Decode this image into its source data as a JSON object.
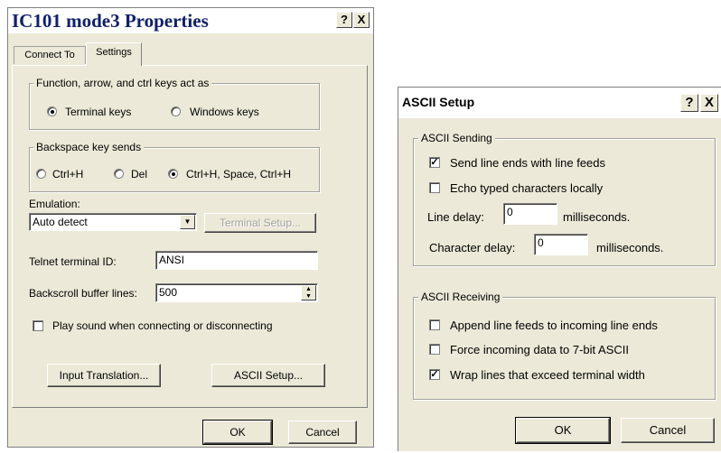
{
  "properties": {
    "title": "IC101 mode3 Properties",
    "help_glyph": "?",
    "close_glyph": "X",
    "tabs": [
      {
        "label": "Connect To",
        "active": false
      },
      {
        "label": "Settings",
        "active": true
      }
    ],
    "function_keys_group": {
      "legend": "Function, arrow, and ctrl keys act as",
      "options": [
        {
          "label": "Terminal keys",
          "selected": true
        },
        {
          "label": "Windows keys",
          "selected": false
        }
      ]
    },
    "backspace_group": {
      "legend": "Backspace key sends",
      "options": [
        {
          "label": "Ctrl+H",
          "selected": false
        },
        {
          "label": "Del",
          "selected": false
        },
        {
          "label": "Ctrl+H, Space, Ctrl+H",
          "selected": true
        }
      ]
    },
    "emulation": {
      "label": "Emulation:",
      "value": "Auto detect",
      "terminal_setup_label": "Terminal Setup..."
    },
    "telnet_id": {
      "label": "Telnet terminal ID:",
      "value": "ANSI"
    },
    "backscroll": {
      "label": "Backscroll buffer lines:",
      "value": "500"
    },
    "play_sound": {
      "label": "Play sound when connecting or disconnecting",
      "checked": false
    },
    "input_translation_label": "Input Translation...",
    "ascii_setup_label": "ASCII Setup...",
    "ok_label": "OK",
    "cancel_label": "Cancel"
  },
  "ascii_setup": {
    "title": "ASCII Setup",
    "help_glyph": "?",
    "close_glyph": "X",
    "sending": {
      "legend": "ASCII Sending",
      "send_line_ends": {
        "label": "Send line ends with line feeds",
        "checked": true
      },
      "echo_typed": {
        "label": "Echo typed characters locally",
        "checked": false
      },
      "line_delay": {
        "label": "Line delay:",
        "value": "0",
        "unit": "milliseconds."
      },
      "character_delay": {
        "label": "Character delay:",
        "value": "0",
        "unit": "milliseconds."
      }
    },
    "receiving": {
      "legend": "ASCII Receiving",
      "append_line_feeds": {
        "label": "Append line feeds to incoming line ends",
        "checked": false
      },
      "force_7bit": {
        "label": "Force incoming data to 7-bit ASCII",
        "checked": false
      },
      "wrap_lines": {
        "label": "Wrap lines that exceed terminal width",
        "checked": true
      }
    },
    "ok_label": "OK",
    "cancel_label": "Cancel"
  },
  "glyphs": {
    "check": "✓",
    "dropdown_arrow": "▼",
    "spin_up": "▲",
    "spin_down": "▼"
  },
  "icons": [
    "help-icon",
    "close-icon",
    "chevron-down-icon",
    "spin-up-icon",
    "spin-down-icon",
    "checkmark-icon"
  ]
}
